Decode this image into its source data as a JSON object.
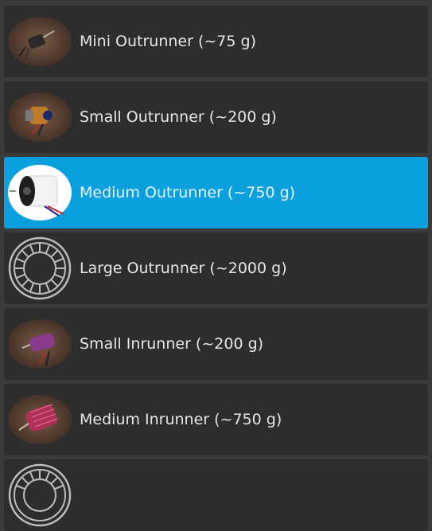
{
  "motors": [
    {
      "label": "Mini Outrunner (~75 g)",
      "icon": "mini-outrunner-photo-icon",
      "selected": false
    },
    {
      "label": "Small Outrunner (~200 g)",
      "icon": "small-outrunner-photo-icon",
      "selected": false
    },
    {
      "label": "Medium Outrunner (~750 g)",
      "icon": "medium-outrunner-photo-icon",
      "selected": true
    },
    {
      "label": "Large Outrunner (~2000 g)",
      "icon": "outrunner-placeholder-icon",
      "selected": false
    },
    {
      "label": "Small Inrunner (~200 g)",
      "icon": "small-inrunner-photo-icon",
      "selected": false
    },
    {
      "label": "Medium Inrunner (~750 g)",
      "icon": "medium-inrunner-photo-icon",
      "selected": false
    },
    {
      "label": "",
      "icon": "outrunner-placeholder-icon",
      "selected": false
    }
  ],
  "colors": {
    "background": "#3a3a3a",
    "item_background": "#2e2d2d",
    "selected_background": "#0aa0de",
    "text": "#e6e6e6"
  }
}
